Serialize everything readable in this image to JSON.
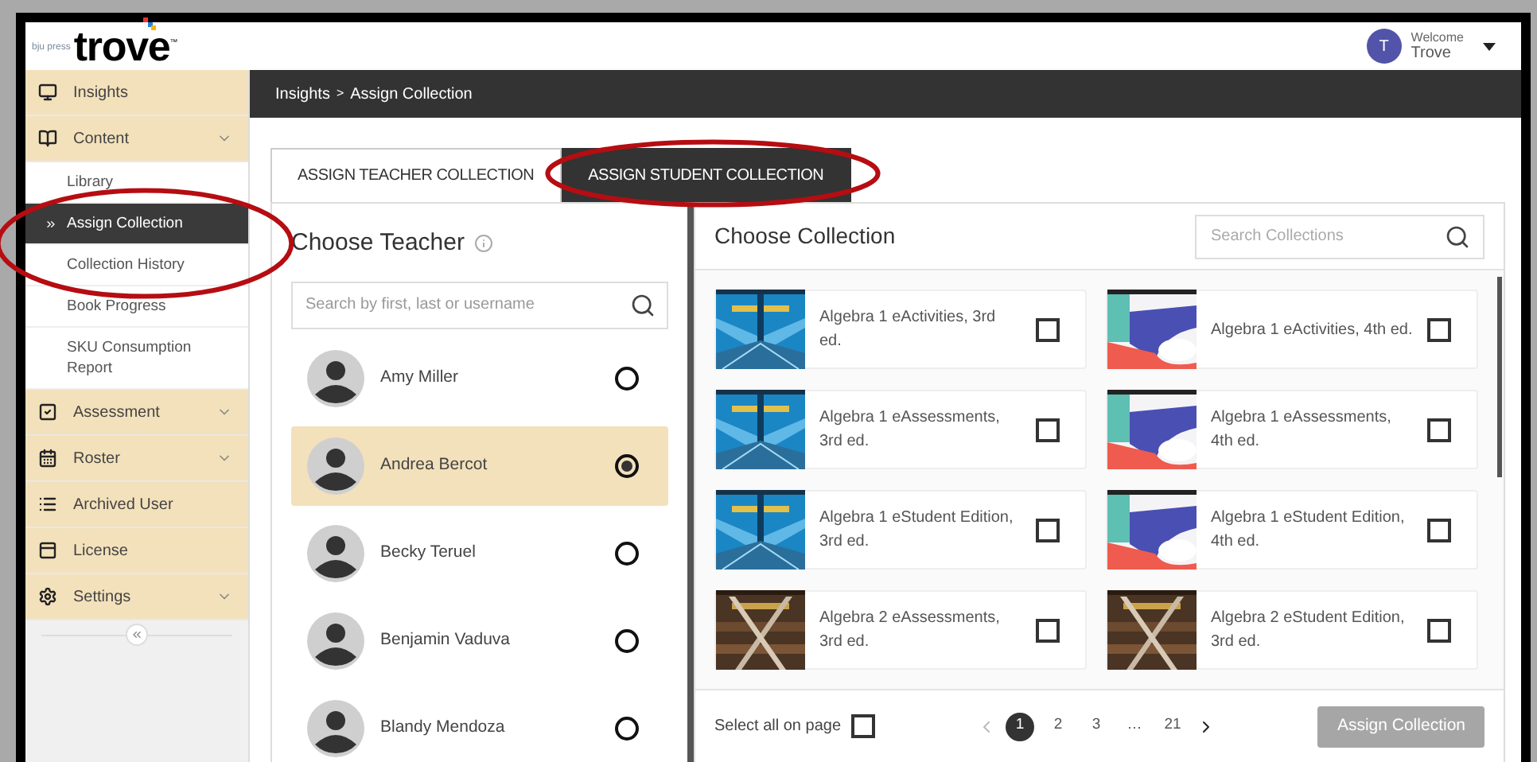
{
  "header": {
    "logo_small": "bju press",
    "logo": "trove",
    "logo_tm": "™",
    "avatar": "T",
    "welcome": "Welcome",
    "user": "Trove"
  },
  "breadcrumb": {
    "items": [
      "Insights",
      "Assign Collection"
    ],
    "separator": ">"
  },
  "sidebar": {
    "items": [
      {
        "label": "Insights",
        "kind": "link"
      },
      {
        "label": "Content",
        "kind": "group",
        "expanded": true,
        "children": [
          {
            "label": "Library",
            "selected": false,
            "circled": false
          },
          {
            "label": "Assign Collection",
            "selected": true,
            "circled": true
          },
          {
            "label": "Collection History",
            "selected": false,
            "circled": false
          },
          {
            "label": "Book Progress",
            "selected": false,
            "circled": false
          },
          {
            "label": "SKU Consumption Report",
            "selected": false,
            "circled": false
          }
        ]
      },
      {
        "label": "Assessment",
        "kind": "group"
      },
      {
        "label": "Roster",
        "kind": "group"
      },
      {
        "label": "Archived User",
        "kind": "link"
      },
      {
        "label": "License",
        "kind": "link"
      },
      {
        "label": "Settings",
        "kind": "group"
      }
    ]
  },
  "tabs": [
    {
      "label": "ASSIGN TEACHER COLLECTION",
      "selected": false,
      "circled": false
    },
    {
      "label": "ASSIGN STUDENT COLLECTION",
      "selected": true,
      "circled": true
    }
  ],
  "teachers": {
    "title": "Choose Teacher",
    "search": {
      "placeholder": "Search by first, last or username"
    },
    "rows": [
      {
        "name": "Amy Miller",
        "selected": false
      },
      {
        "name": "Andrea Bercot",
        "selected": true
      },
      {
        "name": "Becky Teruel",
        "selected": false
      },
      {
        "name": "Benjamin Vaduva",
        "selected": false
      },
      {
        "name": "Blandy Mendoza",
        "selected": false
      }
    ]
  },
  "collections": {
    "title": "Choose Collection",
    "search": {
      "placeholder": "Search Collections"
    },
    "items": [
      {
        "title": "Algebra 1 eActivities, 3rd ed.",
        "checked": false
      },
      {
        "title": "Algebra 1 eActivities, 4th ed.",
        "checked": false
      },
      {
        "title": "Algebra 1 eAssessments, 3rd ed.",
        "checked": false
      },
      {
        "title": "Algebra 1 eAssessments, 4th ed.",
        "checked": false
      },
      {
        "title": "Algebra 1 eStudent Edition, 3rd ed.",
        "checked": false
      },
      {
        "title": "Algebra 1 eStudent Edition, 4th ed.",
        "checked": false
      },
      {
        "title": "Algebra 2 eAssessments, 3rd ed.",
        "checked": false
      },
      {
        "title": "Algebra 2 eStudent Edition, 3rd ed.",
        "checked": false
      }
    ],
    "select_all": {
      "label": "Select all on page",
      "checked": false
    },
    "pages": [
      {
        "label": "1",
        "selected": true
      },
      {
        "label": "2",
        "selected": false
      },
      {
        "label": "3",
        "selected": false
      },
      {
        "label": "…",
        "selected": false
      },
      {
        "label": "21",
        "selected": false
      }
    ],
    "prev_disabled": true,
    "assign_button": {
      "label": "Assign Collection",
      "disabled": true
    }
  }
}
